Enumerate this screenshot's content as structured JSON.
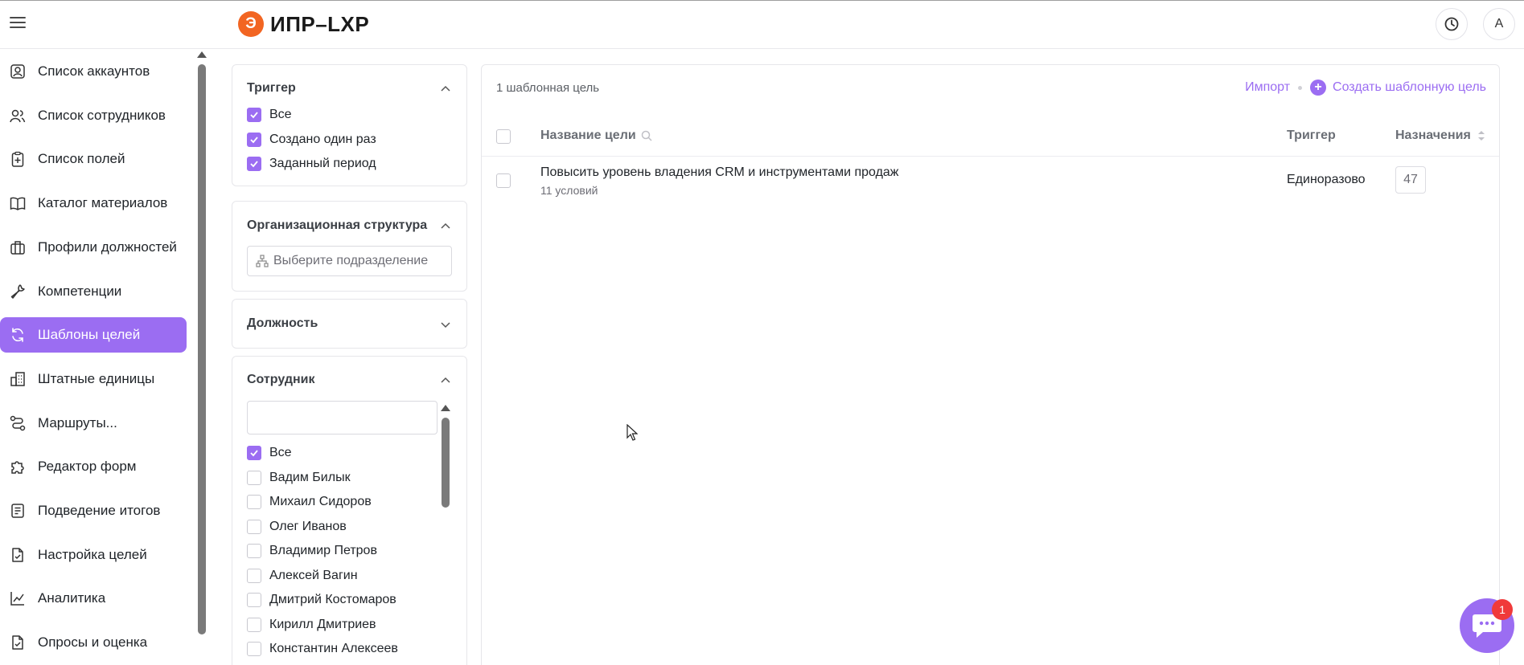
{
  "app": {
    "logo_letter": "Э",
    "logo_text": "ИПР–LXP",
    "accent_color": "#9b6df2",
    "logo_color": "#f26522",
    "avatar_initial": "A"
  },
  "sidebar": {
    "items": [
      {
        "label": "Список аккаунтов",
        "icon": "user-card-icon"
      },
      {
        "label": "Список сотрудников",
        "icon": "users-icon"
      },
      {
        "label": "Список полей",
        "icon": "clipboard-plus-icon"
      },
      {
        "label": "Каталог материалов",
        "icon": "book-icon"
      },
      {
        "label": "Профили должностей",
        "icon": "briefcase-icon"
      },
      {
        "label": "Компетенции",
        "icon": "wrench-icon"
      },
      {
        "label": "Шаблоны целей",
        "icon": "refresh-icon",
        "active": true
      },
      {
        "label": "Штатные единицы",
        "icon": "building-icon"
      },
      {
        "label": "Маршруты...",
        "icon": "route-icon"
      },
      {
        "label": "Редактор форм",
        "icon": "puzzle-icon"
      },
      {
        "label": "Подведение итогов",
        "icon": "checklist-icon"
      },
      {
        "label": "Настройка целей",
        "icon": "doc-check-icon"
      },
      {
        "label": "Аналитика",
        "icon": "chart-line-icon"
      },
      {
        "label": "Опросы и оценка",
        "icon": "doc-check-icon"
      }
    ]
  },
  "filters": {
    "trigger": {
      "title": "Триггер",
      "options": [
        {
          "label": "Все",
          "checked": true
        },
        {
          "label": "Создано один раз",
          "checked": true
        },
        {
          "label": "Заданный период",
          "checked": true
        }
      ]
    },
    "org": {
      "title": "Организационная структура",
      "placeholder": "Выберите подразделение"
    },
    "position": {
      "title": "Должность"
    },
    "employee": {
      "title": "Сотрудник",
      "search_value": "",
      "options": [
        {
          "label": "Все",
          "checked": true
        },
        {
          "label": "Вадим Билык",
          "checked": false
        },
        {
          "label": "Михаил Сидоров",
          "checked": false
        },
        {
          "label": "Олег Иванов",
          "checked": false
        },
        {
          "label": "Владимир Петров",
          "checked": false
        },
        {
          "label": "Алексей Вагин",
          "checked": false
        },
        {
          "label": "Дмитрий Костомаров",
          "checked": false
        },
        {
          "label": "Кирилл Дмитриев",
          "checked": false
        },
        {
          "label": "Константин Алексеев",
          "checked": false
        }
      ]
    }
  },
  "main": {
    "count_label": "1 шаблонная цель",
    "import_label": "Импорт",
    "create_label": "Создать шаблонную цель",
    "columns": {
      "name": "Название цели",
      "trigger": "Триггер",
      "assignments": "Назначения"
    },
    "rows": [
      {
        "title": "Повысить уровень владения CRM и инструментами продаж",
        "subtitle": "11 условий",
        "trigger": "Единоразово",
        "assignments": "47"
      }
    ]
  },
  "chat": {
    "badge": "1"
  }
}
